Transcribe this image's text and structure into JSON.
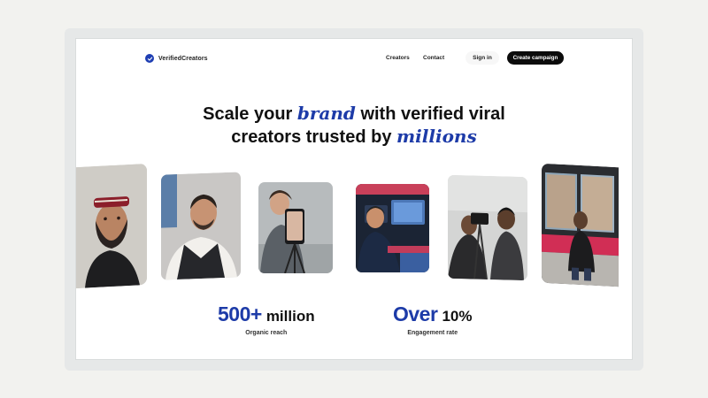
{
  "nav": {
    "logo_text": "VerifiedCreators",
    "links": [
      "Creators",
      "Contact"
    ],
    "signin_label": "Sign in",
    "cta_label": "Create campaign"
  },
  "hero": {
    "line1_a": "Scale your ",
    "line1_em": "brand",
    "line1_b": " with verified viral",
    "line2_a": "creators trusted by ",
    "line2_em": "millions"
  },
  "stats": [
    {
      "big": "500+",
      "small": "million",
      "label": "Organic reach"
    },
    {
      "big": "Over",
      "small": "10%",
      "label": "Engagement rate"
    }
  ],
  "cards": [
    {
      "name": "creator-photo-headband"
    },
    {
      "name": "creator-photo-vest"
    },
    {
      "name": "creator-photo-phone-rig"
    },
    {
      "name": "creator-photo-editing-desk"
    },
    {
      "name": "creator-photo-camera-crew"
    },
    {
      "name": "creator-photo-street-poster"
    }
  ],
  "colors": {
    "accent": "#1d3ba8",
    "cta_bg": "#0b0b0b",
    "backdrop": "#f2f2ef"
  }
}
